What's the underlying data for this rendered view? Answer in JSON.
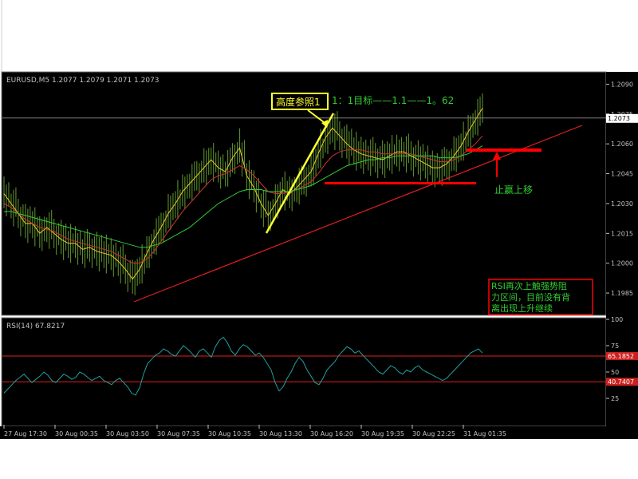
{
  "chart_data": [
    {
      "type": "line",
      "panel": "price",
      "title": "EURUSD,M5  1.2077 1.2079 1.2071 1.2073",
      "symbol": "EURUSD,M5",
      "ohlc": [
        "1.2077",
        "1.2079",
        "1.2071",
        "1.2073"
      ],
      "current_price": "1.2073",
      "ylim": [
        1.1975,
        1.2095
      ],
      "y_ticks": [
        "1.2090",
        "1.2075",
        "1.2060",
        "1.2045",
        "1.2030",
        "1.2015",
        "1.2000",
        "1.1985"
      ],
      "x_ticks": [
        "27 Aug 17:30",
        "30 Aug 00:35",
        "30 Aug 03:50",
        "30 Aug 07:35",
        "30 Aug 10:35",
        "30 Aug 13:30",
        "30 Aug 16:20",
        "30 Aug 19:35",
        "30 Aug 22:25",
        "31 Aug 01:35"
      ],
      "grid": false,
      "series": [
        {
          "values": [
            1.2035,
            1.203,
            1.2025,
            1.202,
            1.202,
            1.2015,
            1.2018,
            1.2015,
            1.2012,
            1.201,
            1.201,
            1.2007,
            1.2008,
            1.2006,
            1.2005,
            1.2004,
            1.2001,
            1.1997,
            1.1992,
            1.1997,
            1.2005,
            1.2012,
            1.2018,
            1.2025,
            1.203,
            1.2036,
            1.204,
            1.2044,
            1.2048,
            1.2052,
            1.2048,
            1.2046,
            1.2053,
            1.2058,
            1.2044,
            1.2038,
            1.203,
            1.2024,
            1.203,
            1.2037,
            1.2035,
            1.2038,
            1.2042,
            1.2046,
            1.2055,
            1.2063,
            1.2068,
            1.2064,
            1.206,
            1.2057,
            1.2055,
            1.2054,
            1.2053,
            1.2052,
            1.2054,
            1.2056,
            1.2056,
            1.2054,
            1.2052,
            1.205,
            1.2048,
            1.2048,
            1.205,
            1.2054,
            1.2059,
            1.2066,
            1.2072,
            1.2078
          ]
        },
        {
          "values": [
            1.203,
            1.2028,
            1.2025,
            1.2022,
            1.202,
            1.2018,
            1.2017,
            1.2016,
            1.2014,
            1.2012,
            1.2011,
            1.201,
            1.2009,
            1.2008,
            1.2007,
            1.2006,
            1.2004,
            1.2002,
            1.2,
            1.2,
            1.2002,
            1.2006,
            1.2011,
            1.2016,
            1.2021,
            1.2026,
            1.203,
            1.2034,
            1.2038,
            1.2042,
            1.2044,
            1.2045,
            1.2047,
            1.2049,
            1.2047,
            1.2044,
            1.204,
            1.2036,
            1.2035,
            1.2035,
            1.2036,
            1.2037,
            1.2039,
            1.2041,
            1.2045,
            1.205,
            1.2054,
            1.2056,
            1.2057,
            1.2057,
            1.2057,
            1.2056,
            1.2056,
            1.2055,
            1.2055,
            1.2055,
            1.2055,
            1.2055,
            1.2054,
            1.2053,
            1.2052,
            1.2051,
            1.2051,
            1.2052,
            1.2054,
            1.2057,
            1.206,
            1.2064
          ]
        },
        {
          "values": [
            1.2026,
            1.2026,
            1.2025,
            1.2024,
            1.2023,
            1.2022,
            1.2021,
            1.202,
            1.2019,
            1.2018,
            1.2017,
            1.2016,
            1.2015,
            1.2014,
            1.2013,
            1.2012,
            1.2011,
            1.201,
            1.2009,
            1.2008,
            1.2008,
            1.2009,
            1.201,
            1.2012,
            1.2014,
            1.2016,
            1.2018,
            1.2021,
            1.2024,
            1.2027,
            1.203,
            1.2032,
            1.2034,
            1.2036,
            1.2037,
            1.2037,
            1.2037,
            1.2036,
            1.2036,
            1.2036,
            1.2036,
            1.2037,
            1.2038,
            1.2039,
            1.2041,
            1.2043,
            1.2045,
            1.2047,
            1.2049,
            1.205,
            1.2051,
            1.2052,
            1.2052,
            1.2053,
            1.2053,
            1.2054,
            1.2054,
            1.2054,
            1.2054,
            1.2054,
            1.2054,
            1.2053,
            1.2053,
            1.2053,
            1.2054,
            1.2055,
            1.2057,
            1.2059
          ]
        }
      ],
      "support_line": {
        "from": [
          1.1983
        ],
        "to": [
          1.2069
        ]
      },
      "annotations": {
        "height_ref_label": "高度参照1",
        "target_text": "1：1目标——1.1——1。62",
        "stop_profit_label": "止赢上移",
        "rsi_note": [
          "RSI再次上触强势阻",
          "力区间，目前没有背",
          "离出现上升继续"
        ]
      },
      "colors": {
        "background": "#000000",
        "price_line": "#5a8c2a",
        "ma_fast": "#e8c830",
        "ma_mid": "#cc3333",
        "ma_slow": "#33cc33",
        "support": "#e02020",
        "annotation_red": "#ff0000",
        "annotation_yellow": "#ffff33",
        "text_green": "#33cc33",
        "axis": "#c0c0c0"
      }
    },
    {
      "type": "line",
      "panel": "rsi",
      "title": "RSI(14)  67.8217",
      "indicator_name": "RSI(14)",
      "value": "67.8217",
      "ylim": [
        0,
        100
      ],
      "y_ticks": [
        "100",
        "75",
        "50",
        "25"
      ],
      "levels": [
        "65.1852",
        "40.7407"
      ],
      "level_values": [
        65.1852,
        40.7407
      ],
      "series": [
        {
          "values": [
            30,
            34,
            38,
            42,
            45,
            48,
            44,
            40,
            43,
            46,
            50,
            47,
            42,
            40,
            44,
            48,
            46,
            43,
            45,
            50,
            48,
            45,
            42,
            44,
            46,
            42,
            40,
            38,
            42,
            44,
            40,
            36,
            30,
            28,
            35,
            48,
            58,
            62,
            66,
            68,
            72,
            70,
            67,
            65,
            70,
            75,
            72,
            68,
            64,
            70,
            72,
            68,
            64,
            74,
            80,
            83,
            78,
            70,
            66,
            72,
            76,
            74,
            70,
            66,
            68,
            64,
            58,
            52,
            40,
            32,
            36,
            44,
            50,
            58,
            64,
            60,
            52,
            46,
            40,
            38,
            44,
            52,
            56,
            60,
            66,
            70,
            74,
            72,
            68,
            70,
            66,
            62,
            58,
            54,
            50,
            48,
            52,
            56,
            54,
            50,
            48,
            52,
            50,
            54,
            56,
            52,
            50,
            48,
            46,
            44,
            42,
            44,
            48,
            52,
            56,
            60,
            64,
            68,
            70,
            72,
            68
          ]
        }
      ],
      "colors": {
        "line": "#20a0a0",
        "level": "#e02020",
        "background": "#000000"
      }
    }
  ]
}
